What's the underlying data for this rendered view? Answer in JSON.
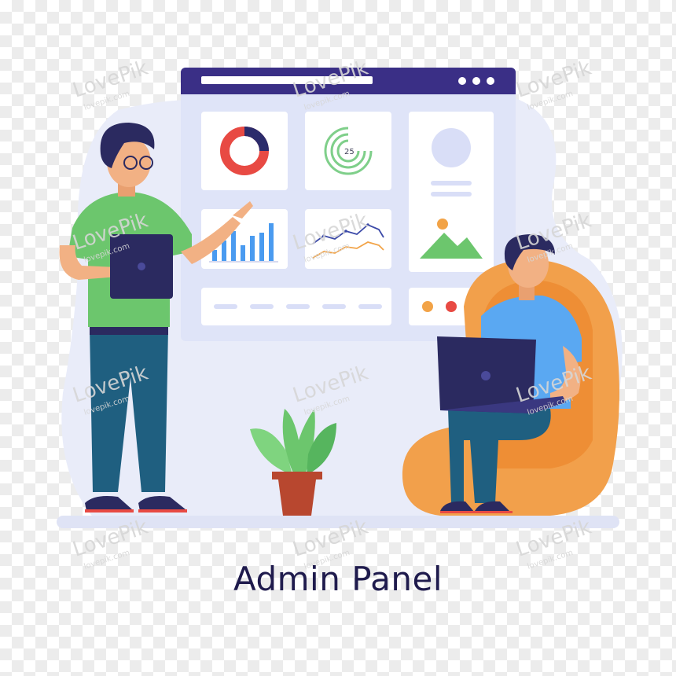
{
  "caption": "Admin Panel",
  "dashboard": {
    "gauge_value": "25"
  },
  "watermark": {
    "brand": "LovePik",
    "url": "lovepik.com"
  },
  "colors": {
    "window_bar": "#3a2f86",
    "panel_bg": "#dfe4f8",
    "card_bg": "#ffffff",
    "donut_red": "#e84a43",
    "donut_navy": "#2b2b6b",
    "gauge_green": "#7fcf8a",
    "bar_blue": "#4a9bf0",
    "line_navy": "#3c4aa8",
    "line_orange": "#f2a347",
    "chair_orange": "#f2a04b",
    "shirt_green": "#6cc66d",
    "shirt_blue": "#5aa8f2",
    "pants_teal": "#1f5f80",
    "laptop": "#2b2a60",
    "caption": "#1f1b4d"
  },
  "icons": {
    "window_dots": "window-dots-icon",
    "image_placeholder": "mountain-image-icon",
    "avatar": "avatar-placeholder-icon"
  }
}
